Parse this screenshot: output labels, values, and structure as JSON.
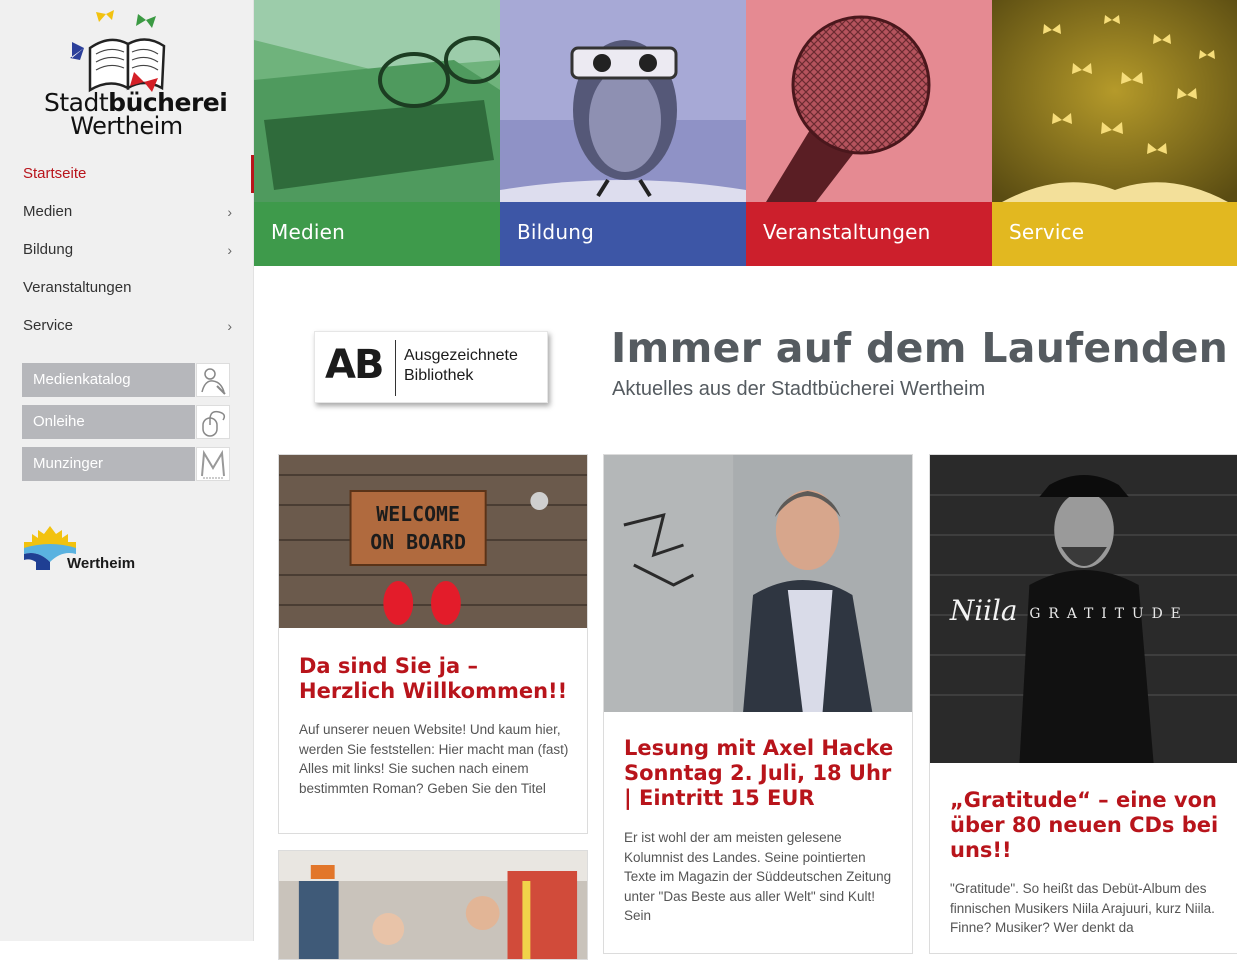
{
  "brand": {
    "logo_line1_normal": "Stadt",
    "logo_line1_bold": "bücherei",
    "logo_line2": "Wertheim",
    "accent": "#b8141b"
  },
  "nav": {
    "items": [
      {
        "label": "Startseite",
        "active": true,
        "has_submenu": false
      },
      {
        "label": "Medien",
        "active": false,
        "has_submenu": true
      },
      {
        "label": "Bildung",
        "active": false,
        "has_submenu": true
      },
      {
        "label": "Veranstaltungen",
        "active": false,
        "has_submenu": false
      },
      {
        "label": "Service",
        "active": false,
        "has_submenu": true
      }
    ],
    "chevron": "›"
  },
  "quicklinks": [
    {
      "label": "Medienkatalog",
      "icon": "catalog-icon"
    },
    {
      "label": "Onleihe",
      "icon": "mouse-icon"
    },
    {
      "label": "Munzinger",
      "icon": "munzinger-icon"
    }
  ],
  "city_logo": {
    "name": "Wertheim"
  },
  "tiles": [
    {
      "label": "Medien",
      "color": "#3e9a4b",
      "icon": "book-glasses-image"
    },
    {
      "label": "Bildung",
      "color": "#3d56a6",
      "icon": "owl-image"
    },
    {
      "label": "Veranstaltungen",
      "color": "#cc1f2c",
      "icon": "microphone-image"
    },
    {
      "label": "Service",
      "color": "#e2b820",
      "icon": "butterflies-book-image"
    }
  ],
  "award": {
    "mark": "AB",
    "line1": "Ausgezeichnete",
    "line2": "Bibliothek"
  },
  "hero": {
    "title": "Immer auf dem Laufenden",
    "subtitle": "Aktuelles aus der Stadtbücherei Wertheim"
  },
  "cards": [
    {
      "title": "Da sind Sie ja – Herzlich Willkommen!!",
      "text": "Auf unserer neuen Website! Und kaum hier, werden Sie feststellen: Hier macht man (fast) Alles mit links! Sie suchen nach einem bestimmten Roman? Geben Sie den Titel",
      "image_text": "WELCOME ON BOARD"
    },
    {
      "title_part1": "Lesung mit Axel Hacke Sonntag ",
      "title_bold": "2. Juli, 18 Uhr",
      "title_part2": " | Eintritt 15 EUR",
      "text": "Er ist wohl der am meisten gelesene Kolumnist des Landes. Seine pointierten Texte im Magazin der Süddeutschen Zeitung unter \"Das Beste aus aller Welt\" sind Kult! Sein"
    },
    {
      "title": "„Gratitude“ – eine von über 80 neuen CDs bei uns!!",
      "text": "\"Gratitude\". So heißt das Debüt-Album des finnischen Musikers Niila Arajuuri, kurz Niila. Finne? Musiker? Wer denkt da",
      "image_text_script": "Niila",
      "image_text_caps": "GRATITUDE"
    }
  ]
}
